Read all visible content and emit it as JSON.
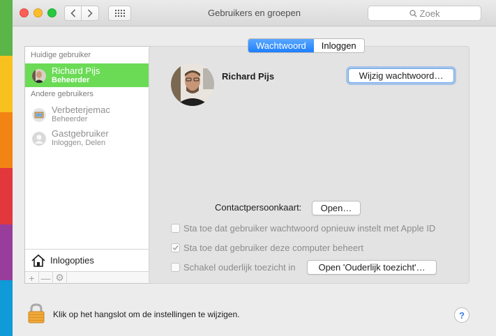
{
  "desktop_strip_colors": [
    "#5bb548",
    "#f9c11d",
    "#f28413",
    "#e2383d",
    "#993d9c",
    "#0f9ad8"
  ],
  "window": {
    "title": "Gebruikers en groepen",
    "search_placeholder": "Zoek",
    "back_icon": "chevron-left-icon",
    "forward_icon": "chevron-right-icon",
    "grid_icon": "show-all-grid-icon"
  },
  "sidebar": {
    "current_user_header": "Huidige gebruiker",
    "other_users_header": "Andere gebruikers",
    "current_user": {
      "name": "Richard Pijs",
      "role": "Beheerder"
    },
    "other_users": [
      {
        "name": "Verbeterjemac",
        "role": "Beheerder",
        "icon": "mac-user-icon"
      },
      {
        "name": "Gastgebruiker",
        "role": "Inloggen, Delen",
        "icon": "guest-user-icon"
      }
    ],
    "login_options_label": "Inlogopties",
    "add_label": "+",
    "remove_label": "—",
    "gear_label": "⚙",
    "selection_color": "#6bdb56"
  },
  "tabs": {
    "password": "Wachtwoord",
    "login_items": "Inloggen",
    "active": "Wachtwoord",
    "accent_color": "#1e7fff"
  },
  "user_detail": {
    "name": "Richard Pijs",
    "change_password_button": "Wijzig wachtwoord…",
    "contact_card_label": "Contactpersoonkaart:",
    "contact_card_button": "Open…",
    "options": [
      {
        "label": "Sta toe dat gebruiker wachtwoord opnieuw instelt met Apple ID",
        "checked": false
      },
      {
        "label": "Sta toe dat gebruiker deze computer beheert",
        "checked": true
      },
      {
        "label": "Schakel ouderlijk toezicht in",
        "checked": false
      }
    ],
    "parental_controls_button": "Open 'Ouderlijk toezicht'…"
  },
  "footer": {
    "lock_text": "Klik op het hangslot om de instellingen te wijzigen.",
    "help_label": "?"
  }
}
